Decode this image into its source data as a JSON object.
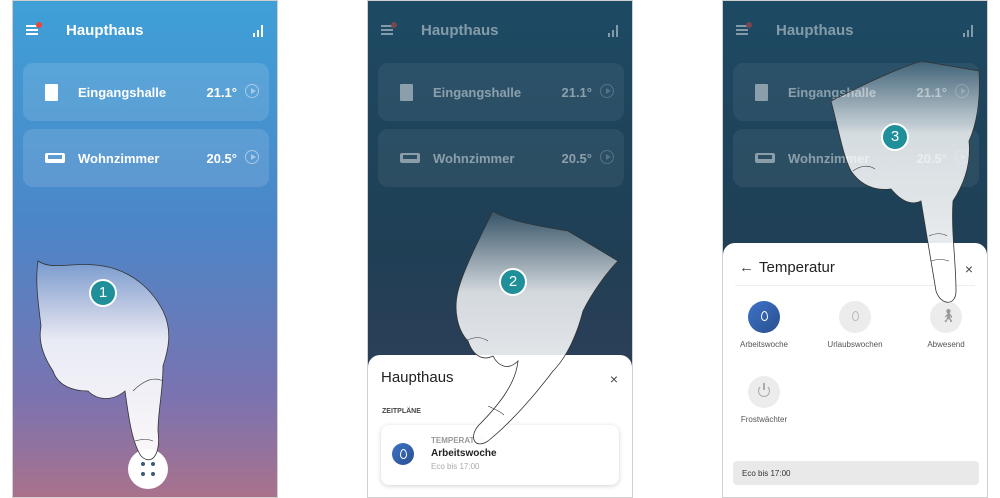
{
  "home": {
    "title": "Haupthaus"
  },
  "rooms": [
    {
      "name": "Eingangshalle",
      "temp": "21.1°"
    },
    {
      "name": "Wohnzimmer",
      "temp": "20.5°"
    }
  ],
  "steps": [
    "1",
    "2",
    "3"
  ],
  "sheet2": {
    "title": "Haupthaus",
    "close": "×",
    "section": "ZEITPLÄNE",
    "card": {
      "category": "TEMPERATUR",
      "name": "Arbeitswoche",
      "sub": "Eco bis 17:00"
    }
  },
  "sheet3": {
    "back": "←",
    "title": "Temperatur",
    "close": "×",
    "modes": [
      {
        "label": "Arbeitswoche",
        "icon": "flame-icon"
      },
      {
        "label": "Urlaubswochen",
        "icon": "flame-icon"
      },
      {
        "label": "Abwesend",
        "icon": "walking-person-icon"
      },
      {
        "label": "Frostwächter",
        "icon": "power-icon"
      }
    ],
    "status": "Eco bis 17:00"
  },
  "colors": {
    "accent": "#1f8f9a",
    "mode_active": "#3d73c9"
  }
}
